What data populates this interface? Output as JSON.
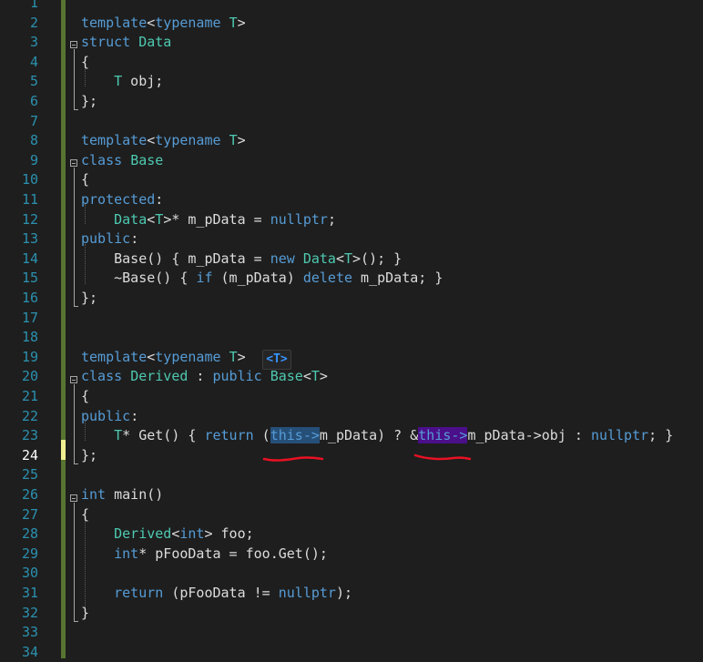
{
  "editor": {
    "lines": [
      {
        "n": "1",
        "segs": []
      },
      {
        "n": "2",
        "segs": [
          {
            "t": "template",
            "c": "kw"
          },
          {
            "t": "<",
            "c": "tx"
          },
          {
            "t": "typename",
            "c": "kw"
          },
          {
            "t": " ",
            "c": "tx"
          },
          {
            "t": "T",
            "c": "ty"
          },
          {
            "t": ">",
            "c": "tx"
          }
        ]
      },
      {
        "n": "3",
        "segs": [
          {
            "t": "struct",
            "c": "kw"
          },
          {
            "t": " ",
            "c": "tx"
          },
          {
            "t": "Data",
            "c": "ty"
          }
        ]
      },
      {
        "n": "4",
        "segs": [
          {
            "t": "{",
            "c": "tx"
          }
        ]
      },
      {
        "n": "5",
        "segs": [
          {
            "t": "    ",
            "c": "tx"
          },
          {
            "t": "T",
            "c": "ty"
          },
          {
            "t": " obj;",
            "c": "tx"
          }
        ]
      },
      {
        "n": "6",
        "segs": [
          {
            "t": "};",
            "c": "tx"
          }
        ]
      },
      {
        "n": "7",
        "segs": []
      },
      {
        "n": "8",
        "segs": [
          {
            "t": "template",
            "c": "kw"
          },
          {
            "t": "<",
            "c": "tx"
          },
          {
            "t": "typename",
            "c": "kw"
          },
          {
            "t": " ",
            "c": "tx"
          },
          {
            "t": "T",
            "c": "ty"
          },
          {
            "t": ">",
            "c": "tx"
          }
        ]
      },
      {
        "n": "9",
        "segs": [
          {
            "t": "class",
            "c": "kw"
          },
          {
            "t": " ",
            "c": "tx"
          },
          {
            "t": "Base",
            "c": "ty"
          }
        ]
      },
      {
        "n": "10",
        "segs": [
          {
            "t": "{",
            "c": "tx"
          }
        ]
      },
      {
        "n": "11",
        "segs": [
          {
            "t": "protected",
            "c": "kw"
          },
          {
            "t": ":",
            "c": "tx"
          }
        ]
      },
      {
        "n": "12",
        "segs": [
          {
            "t": "    ",
            "c": "tx"
          },
          {
            "t": "Data",
            "c": "ty"
          },
          {
            "t": "<",
            "c": "tx"
          },
          {
            "t": "T",
            "c": "ty"
          },
          {
            "t": ">* m_pData = ",
            "c": "tx"
          },
          {
            "t": "nullptr",
            "c": "kw"
          },
          {
            "t": ";",
            "c": "tx"
          }
        ]
      },
      {
        "n": "13",
        "segs": [
          {
            "t": "public",
            "c": "kw"
          },
          {
            "t": ":",
            "c": "tx"
          }
        ]
      },
      {
        "n": "14",
        "segs": [
          {
            "t": "    Base() { m_pData = ",
            "c": "tx"
          },
          {
            "t": "new",
            "c": "kw"
          },
          {
            "t": " ",
            "c": "tx"
          },
          {
            "t": "Data",
            "c": "ty"
          },
          {
            "t": "<",
            "c": "tx"
          },
          {
            "t": "T",
            "c": "ty"
          },
          {
            "t": ">(); }",
            "c": "tx"
          }
        ]
      },
      {
        "n": "15",
        "segs": [
          {
            "t": "    ~Base() { ",
            "c": "tx"
          },
          {
            "t": "if",
            "c": "kw"
          },
          {
            "t": " (m_pData) ",
            "c": "tx"
          },
          {
            "t": "delete",
            "c": "kw"
          },
          {
            "t": " m_pData; }",
            "c": "tx"
          }
        ]
      },
      {
        "n": "16",
        "segs": [
          {
            "t": "};",
            "c": "tx"
          }
        ]
      },
      {
        "n": "17",
        "segs": []
      },
      {
        "n": "18",
        "segs": []
      },
      {
        "n": "19",
        "segs": [
          {
            "t": "template",
            "c": "kw"
          },
          {
            "t": "<",
            "c": "tx"
          },
          {
            "t": "typename",
            "c": "kw"
          },
          {
            "t": " ",
            "c": "tx"
          },
          {
            "t": "T",
            "c": "ty"
          },
          {
            "t": ">",
            "c": "tx"
          }
        ]
      },
      {
        "n": "20",
        "segs": [
          {
            "t": "class",
            "c": "kw"
          },
          {
            "t": " ",
            "c": "tx"
          },
          {
            "t": "Derived",
            "c": "ty"
          },
          {
            "t": " : ",
            "c": "tx"
          },
          {
            "t": "public",
            "c": "kw"
          },
          {
            "t": " ",
            "c": "tx"
          },
          {
            "t": "Base",
            "c": "ty"
          },
          {
            "t": "<",
            "c": "tx"
          },
          {
            "t": "T",
            "c": "ty"
          },
          {
            "t": ">",
            "c": "tx"
          }
        ]
      },
      {
        "n": "21",
        "segs": [
          {
            "t": "{",
            "c": "tx"
          }
        ]
      },
      {
        "n": "22",
        "segs": [
          {
            "t": "public",
            "c": "kw"
          },
          {
            "t": ":",
            "c": "tx"
          }
        ]
      },
      {
        "n": "23",
        "segs": [
          {
            "t": "    ",
            "c": "tx"
          },
          {
            "t": "T",
            "c": "ty"
          },
          {
            "t": "* Get() { ",
            "c": "tx"
          },
          {
            "t": "return",
            "c": "kw"
          },
          {
            "t": " (",
            "c": "tx"
          },
          {
            "t": "this->",
            "c": "kw hl-sel"
          },
          {
            "t": "m_pData) ? &",
            "c": "tx"
          },
          {
            "t": "this->",
            "c": "kw hl-purple"
          },
          {
            "t": "m_pData->obj : ",
            "c": "tx"
          },
          {
            "t": "nullptr",
            "c": "kw"
          },
          {
            "t": "; }",
            "c": "tx"
          }
        ]
      },
      {
        "n": "24",
        "segs": [
          {
            "t": "};",
            "c": "tx"
          }
        ]
      },
      {
        "n": "25",
        "segs": []
      },
      {
        "n": "26",
        "segs": [
          {
            "t": "int",
            "c": "kw"
          },
          {
            "t": " main()",
            "c": "tx"
          }
        ]
      },
      {
        "n": "27",
        "segs": [
          {
            "t": "{",
            "c": "tx"
          }
        ]
      },
      {
        "n": "28",
        "segs": [
          {
            "t": "    ",
            "c": "tx"
          },
          {
            "t": "Derived",
            "c": "ty"
          },
          {
            "t": "<",
            "c": "tx"
          },
          {
            "t": "int",
            "c": "kw"
          },
          {
            "t": "> foo;",
            "c": "tx"
          }
        ]
      },
      {
        "n": "29",
        "segs": [
          {
            "t": "    ",
            "c": "tx"
          },
          {
            "t": "int",
            "c": "kw"
          },
          {
            "t": "* pFooData = foo.Get();",
            "c": "tx"
          }
        ]
      },
      {
        "n": "30",
        "segs": []
      },
      {
        "n": "31",
        "segs": [
          {
            "t": "    ",
            "c": "tx"
          },
          {
            "t": "return",
            "c": "kw"
          },
          {
            "t": " (pFooData != ",
            "c": "tx"
          },
          {
            "t": "nullptr",
            "c": "kw"
          },
          {
            "t": ");",
            "c": "tx"
          }
        ]
      },
      {
        "n": "32",
        "segs": [
          {
            "t": "}",
            "c": "tx"
          }
        ]
      },
      {
        "n": "33",
        "segs": []
      },
      {
        "n": "34",
        "segs": []
      }
    ],
    "active_line": "24",
    "template_hint": "<T>",
    "colors": {
      "background": "#1e1e1e",
      "keyword": "#569cd6",
      "type": "#4ec9b0",
      "line_number": "#2b91af",
      "change_bar_saved": "#577430",
      "change_bar_unsaved": "#efef91",
      "annotation_underline": "#e81123"
    }
  }
}
